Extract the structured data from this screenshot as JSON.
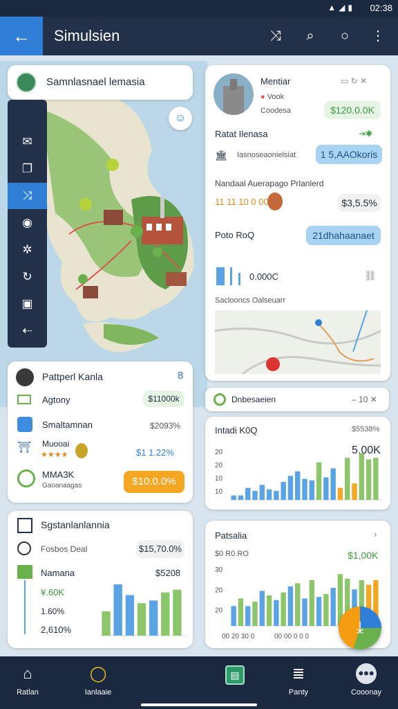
{
  "status": {
    "time": "02:38"
  },
  "appbar": {
    "title": "Simulsien"
  },
  "map_header": {
    "title": "Samnlasnael lemasia"
  },
  "profile_card": {
    "title": "Mentiar",
    "line1": "Vook",
    "line2": "Coodesa",
    "price": "$120.0.0K"
  },
  "info_card": {
    "section1_label": "Ratat Ilenasa",
    "section1_sub": "Iasnoseaonielsiat",
    "section1_pill": "1 5,AAOkoris",
    "section2_label": "Nandaal Auerapago Prlanlerd",
    "section2_values": "11 11 10 0 00",
    "section2_pill": "$3,5.5%",
    "section3_label": "Poto RoQ",
    "section3_pill": "21dhahaanaet",
    "section4_value": "0.000C",
    "section5_label": "Saclooncs Oalseuarr"
  },
  "left_card1": {
    "title": "Pattperl Kanla",
    "badge": "8",
    "rows": [
      {
        "label": "Agtony",
        "value": "$11000k"
      },
      {
        "label": "Smaltamnan",
        "value": "$2093%"
      },
      {
        "label": "Muooai",
        "value": "$1 1.22%"
      },
      {
        "label": "MMA3K",
        "sub": "Gaoanaagas",
        "value": "$10.0.0%"
      }
    ]
  },
  "left_card2": {
    "title": "Sgstanlanlannia",
    "rows": [
      {
        "label": "Fosbos Deal",
        "value": "$15,70.0%"
      },
      {
        "label": "Namana",
        "value": "$5208"
      }
    ],
    "stats": [
      "¥.60K",
      "1.60%",
      "2,610%"
    ]
  },
  "right_mini": {
    "label": "Dnbesaeien",
    "value": "10"
  },
  "right_chart1": {
    "title": "Intadi K0Q",
    "corner": "$5538%",
    "big_value": "5,00K",
    "yticks": [
      "20",
      "20",
      "10",
      "10"
    ]
  },
  "right_chart2": {
    "title": "Patsalia",
    "sub": "$0 R0.RO",
    "big_value": "$1,00K",
    "yticks": [
      "30",
      "20",
      "20"
    ],
    "xticks": [
      "00 20 30 0",
      "00 00 0 0 0"
    ]
  },
  "chart_data": [
    {
      "type": "bar",
      "title": "Intadi K0Q",
      "series": [
        {
          "values": [
            3,
            3,
            8,
            6,
            10,
            7,
            6,
            12,
            16,
            19,
            14,
            13,
            25,
            15,
            21,
            8,
            28,
            11,
            31,
            27,
            28
          ]
        }
      ],
      "ylim": [
        0,
        35
      ]
    },
    {
      "type": "bar",
      "title": "Patsalia",
      "series": [
        {
          "values": [
            13,
            18,
            13,
            16,
            23,
            20,
            17,
            22,
            26,
            28,
            18,
            30,
            19,
            21,
            25,
            34,
            31,
            24,
            30,
            27,
            30
          ]
        }
      ],
      "ylim": [
        0,
        40
      ]
    },
    {
      "type": "bar",
      "title": "Sgstanlanlannia",
      "series": [
        {
          "values": [
            9,
            19,
            15,
            12,
            13,
            16,
            17
          ]
        }
      ],
      "ylim": [
        0,
        20
      ]
    }
  ],
  "bottom_nav": [
    {
      "label": "Ratlan",
      "icon": "home-icon"
    },
    {
      "label": "Ianlaaie",
      "icon": "pin-icon"
    },
    {
      "label": "",
      "icon": "chart-icon"
    },
    {
      "label": "Panty",
      "icon": "analytics-icon"
    },
    {
      "label": "Cooonay",
      "icon": "more-icon"
    }
  ],
  "colors": {
    "accent": "#2f7fd6",
    "green": "#6ab04c",
    "orange": "#f39c12",
    "navy": "#23304a"
  }
}
